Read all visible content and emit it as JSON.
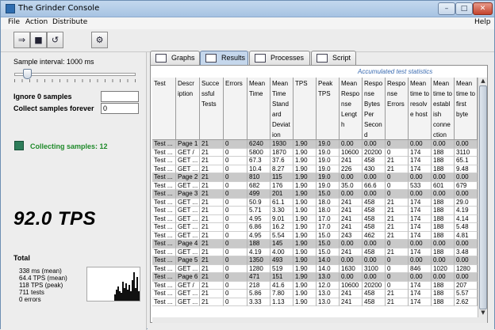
{
  "window": {
    "title": "The Grinder Console",
    "min": "–",
    "max": "□",
    "close": "✕"
  },
  "menu": {
    "file": "File",
    "action": "Action",
    "distribute": "Distribute",
    "help": "Help"
  },
  "toolbar": {
    "start_icon": "⇒",
    "stop_icon": "■",
    "reset_icon": "↺",
    "distribute_icon": "⚙"
  },
  "left": {
    "sample_interval_label": "Sample interval: 1000 ms",
    "slider_fraction": 0.08,
    "ignore_label": "Ignore 0 samples",
    "ignore_value": "",
    "collect_label": "Collect samples forever",
    "collect_value": "0",
    "collecting": "Collecting samples: 12",
    "collecting_color": "#1f8a2a",
    "tps": "92.0 TPS",
    "total_label": "Total",
    "totals": [
      "338 ms (mean)",
      "64.4 TPS (mean)",
      "118 TPS (peak)",
      "711 tests",
      "0 errors"
    ],
    "graph_values": [
      0.2,
      0.35,
      0.45,
      0.3,
      0.25,
      0.6,
      0.4,
      0.55,
      0.35,
      0.5,
      0.3,
      0.65,
      0.9,
      0.4,
      0.75,
      0.3,
      0.5,
      0.35
    ]
  },
  "tabs": [
    {
      "label": "Graphs",
      "icon": "graphs-icon"
    },
    {
      "label": "Results",
      "icon": "results-icon"
    },
    {
      "label": "Processes",
      "icon": "processes-icon"
    },
    {
      "label": "Script",
      "icon": "script-icon"
    }
  ],
  "results": {
    "caption": "Accumulated test statistics",
    "columns": [
      {
        "label": "Test",
        "w": 30
      },
      {
        "label": "Descr\niption",
        "w": 30
      },
      {
        "label": "Succe\nssful\nTests",
        "w": 30
      },
      {
        "label": "Errors",
        "w": 30
      },
      {
        "label": "Mean\nTime",
        "w": 29
      },
      {
        "label": "Mean\nTime\nStand\nard\nDeviat\nion",
        "w": 29
      },
      {
        "label": "TPS",
        "w": 29
      },
      {
        "label": "Peak\nTPS",
        "w": 29
      },
      {
        "label": "Mean\nRespo\nnse\nLength",
        "w": 29
      },
      {
        "label": "Respo\nnse\nBytes\nPer\nSecon\nd",
        "w": 29
      },
      {
        "label": "Respo\nnse\nErrors",
        "w": 29
      },
      {
        "label": "Mean\ntime to\nresolv\ne host",
        "w": 29
      },
      {
        "label": "Mean\ntime to\nestabl\nish\nconne\nction",
        "w": 29
      },
      {
        "label": "Mean\ntime to\nfirst\nbyte",
        "w": 29
      }
    ],
    "rows": [
      {
        "page": true,
        "cells": [
          "Test ...",
          "Page 1",
          "21",
          "0",
          "6240",
          "1930",
          "1.90",
          "19.0",
          "0.00",
          "0.00",
          "0",
          "0.00",
          "0.00",
          "0.00"
        ]
      },
      {
        "page": false,
        "cells": [
          "Test ...",
          "GET /",
          "21",
          "0",
          "5800",
          "1870",
          "1.90",
          "19.0",
          "10600",
          "20200",
          "0",
          "174",
          "188",
          "3110"
        ]
      },
      {
        "page": false,
        "cells": [
          "Test ...",
          "GET ...",
          "21",
          "0",
          "67.3",
          "37.6",
          "1.90",
          "19.0",
          "241",
          "458",
          "21",
          "174",
          "188",
          "65.1"
        ]
      },
      {
        "page": false,
        "cells": [
          "Test ...",
          "GET ...",
          "21",
          "0",
          "10.4",
          "8.27",
          "1.90",
          "19.0",
          "226",
          "430",
          "21",
          "174",
          "188",
          "9.48"
        ]
      },
      {
        "page": true,
        "cells": [
          "Test ...",
          "Page 2",
          "21",
          "0",
          "810",
          "115",
          "1.90",
          "19.0",
          "0.00",
          "0.00",
          "0",
          "0.00",
          "0.00",
          "0.00"
        ]
      },
      {
        "page": false,
        "cells": [
          "Test ...",
          "GET ...",
          "21",
          "0",
          "682",
          "176",
          "1.90",
          "19.0",
          "35.0",
          "66.6",
          "0",
          "533",
          "601",
          "679"
        ]
      },
      {
        "page": true,
        "cells": [
          "Test ...",
          "Page 3",
          "21",
          "0",
          "499",
          "201",
          "1.90",
          "15.0",
          "0.00",
          "0.00",
          "0",
          "0.00",
          "0.00",
          "0.00"
        ]
      },
      {
        "page": false,
        "cells": [
          "Test ...",
          "GET ...",
          "21",
          "0",
          "50.9",
          "61.1",
          "1.90",
          "18.0",
          "241",
          "458",
          "21",
          "174",
          "188",
          "29.0"
        ]
      },
      {
        "page": false,
        "cells": [
          "Test ...",
          "GET ...",
          "21",
          "0",
          "5.71",
          "3.30",
          "1.90",
          "18.0",
          "241",
          "458",
          "21",
          "174",
          "188",
          "4.19"
        ]
      },
      {
        "page": false,
        "cells": [
          "Test ...",
          "GET ...",
          "21",
          "0",
          "4.95",
          "9.01",
          "1.90",
          "17.0",
          "241",
          "458",
          "21",
          "174",
          "188",
          "4.14"
        ]
      },
      {
        "page": false,
        "cells": [
          "Test ...",
          "GET ...",
          "21",
          "0",
          "6.86",
          "16.2",
          "1.90",
          "17.0",
          "241",
          "458",
          "21",
          "174",
          "188",
          "5.48"
        ]
      },
      {
        "page": false,
        "cells": [
          "Test ...",
          "GET ...",
          "21",
          "0",
          "4.95",
          "5.54",
          "1.90",
          "15.0",
          "243",
          "462",
          "21",
          "174",
          "188",
          "4.81"
        ]
      },
      {
        "page": true,
        "cells": [
          "Test ...",
          "Page 4",
          "21",
          "0",
          "188",
          "145",
          "1.90",
          "15.0",
          "0.00",
          "0.00",
          "0",
          "0.00",
          "0.00",
          "0.00"
        ]
      },
      {
        "page": false,
        "cells": [
          "Test ...",
          "GET ...",
          "21",
          "0",
          "4.19",
          "4.00",
          "1.90",
          "15.0",
          "241",
          "458",
          "21",
          "174",
          "188",
          "3.48"
        ]
      },
      {
        "page": true,
        "cells": [
          "Test ...",
          "Page 5",
          "21",
          "0",
          "1350",
          "493",
          "1.90",
          "14.0",
          "0.00",
          "0.00",
          "0",
          "0.00",
          "0.00",
          "0.00"
        ]
      },
      {
        "page": false,
        "cells": [
          "Test ...",
          "GET ...",
          "21",
          "0",
          "1280",
          "519",
          "1.90",
          "14.0",
          "1630",
          "3100",
          "0",
          "846",
          "1020",
          "1280"
        ]
      },
      {
        "page": true,
        "cells": [
          "Test ...",
          "Page 6",
          "21",
          "0",
          "471",
          "151",
          "1.90",
          "13.0",
          "0.00",
          "0.00",
          "0",
          "0.00",
          "0.00",
          "0.00"
        ]
      },
      {
        "page": false,
        "cells": [
          "Test ...",
          "GET /",
          "21",
          "0",
          "218",
          "41.6",
          "1.90",
          "12.0",
          "10600",
          "20200",
          "0",
          "174",
          "188",
          "207"
        ]
      },
      {
        "page": false,
        "cells": [
          "Test ...",
          "GET ...",
          "21",
          "0",
          "5.86",
          "7.80",
          "1.90",
          "13.0",
          "241",
          "458",
          "21",
          "174",
          "188",
          "5.57"
        ]
      },
      {
        "page": false,
        "cells": [
          "Test ...",
          "GET ...",
          "21",
          "0",
          "3.33",
          "1.13",
          "1.90",
          "13.0",
          "241",
          "458",
          "21",
          "174",
          "188",
          "2.62"
        ]
      }
    ]
  }
}
